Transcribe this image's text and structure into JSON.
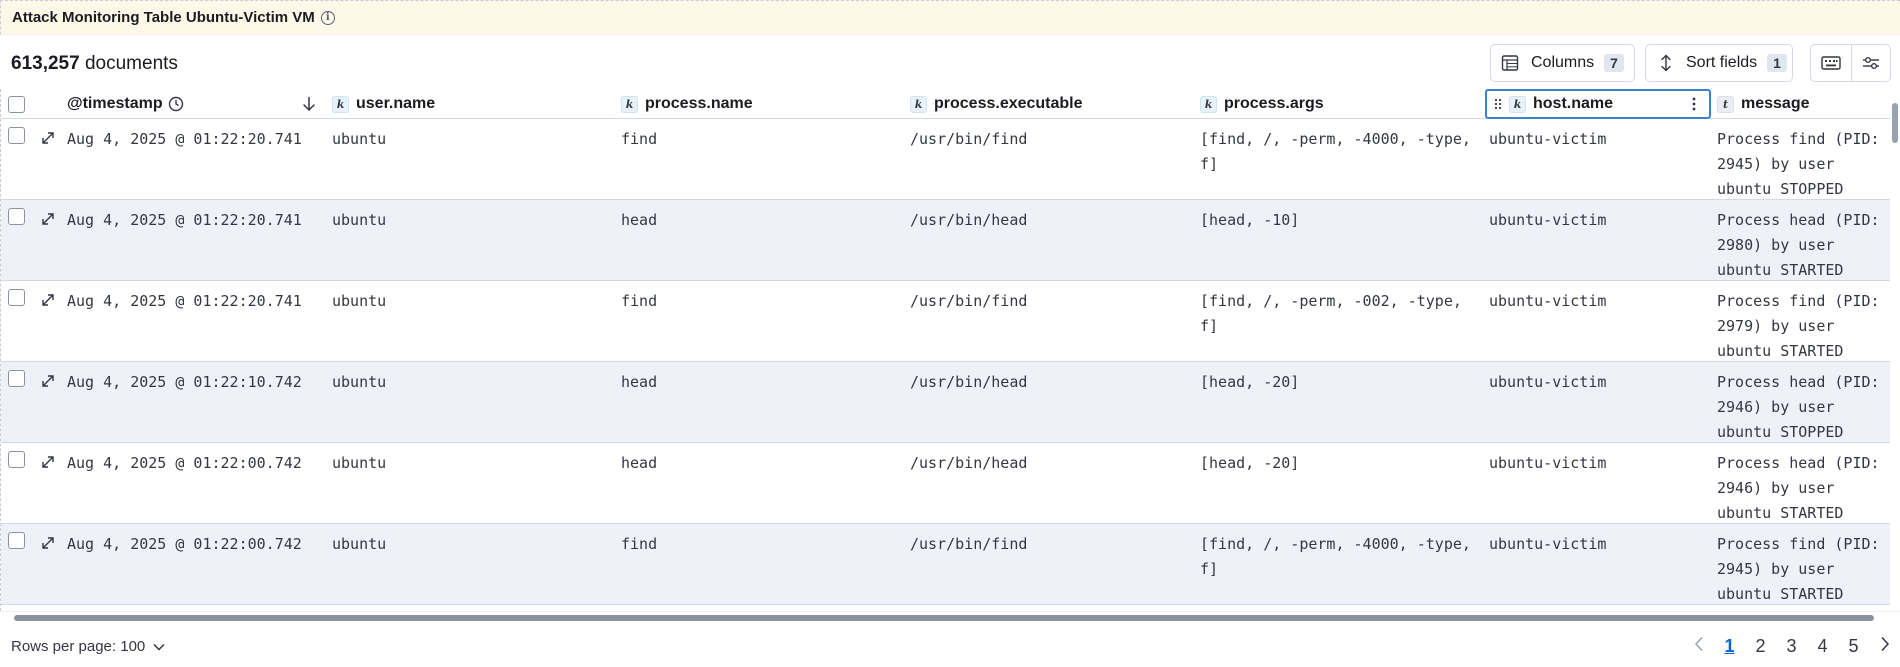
{
  "panel": {
    "title": "Attack Monitoring Table Ubuntu-Victim VM"
  },
  "toolbar": {
    "doc_count_number": "613,257",
    "doc_count_label": "documents",
    "columns_label": "Columns",
    "columns_count": "7",
    "sort_label": "Sort fields",
    "sort_count": "1"
  },
  "columns": [
    {
      "label": "@timestamp",
      "type": ""
    },
    {
      "label": "user.name",
      "type": "k"
    },
    {
      "label": "process.name",
      "type": "k"
    },
    {
      "label": "process.executable",
      "type": "k"
    },
    {
      "label": "process.args",
      "type": "k"
    },
    {
      "label": "host.name",
      "type": "k"
    },
    {
      "label": "message",
      "type": "t"
    }
  ],
  "rows": [
    {
      "timestamp": "Aug 4, 2025 @ 01:22:20.741",
      "user": "ubuntu",
      "process": "find",
      "executable": "/usr/bin/find",
      "args": "[find, /, -perm, -4000, -type, f]",
      "host": "ubuntu-victim",
      "message": "Process find (PID: 2945) by user ubuntu STOPPED"
    },
    {
      "timestamp": "Aug 4, 2025 @ 01:22:20.741",
      "user": "ubuntu",
      "process": "head",
      "executable": "/usr/bin/head",
      "args": "[head, -10]",
      "host": "ubuntu-victim",
      "message": "Process head (PID: 2980) by user ubuntu STARTED"
    },
    {
      "timestamp": "Aug 4, 2025 @ 01:22:20.741",
      "user": "ubuntu",
      "process": "find",
      "executable": "/usr/bin/find",
      "args": "[find, /, -perm, -002, -type, f]",
      "host": "ubuntu-victim",
      "message": "Process find (PID: 2979) by user ubuntu STARTED"
    },
    {
      "timestamp": "Aug 4, 2025 @ 01:22:10.742",
      "user": "ubuntu",
      "process": "head",
      "executable": "/usr/bin/head",
      "args": "[head, -20]",
      "host": "ubuntu-victim",
      "message": "Process head (PID: 2946) by user ubuntu STOPPED"
    },
    {
      "timestamp": "Aug 4, 2025 @ 01:22:00.742",
      "user": "ubuntu",
      "process": "head",
      "executable": "/usr/bin/head",
      "args": "[head, -20]",
      "host": "ubuntu-victim",
      "message": "Process head (PID: 2946) by user ubuntu STARTED"
    },
    {
      "timestamp": "Aug 4, 2025 @ 01:22:00.742",
      "user": "ubuntu",
      "process": "find",
      "executable": "/usr/bin/find",
      "args": "[find, /, -perm, -4000, -type, f]",
      "host": "ubuntu-victim",
      "message": "Process find (PID: 2945) by user ubuntu STARTED"
    }
  ],
  "footer": {
    "rows_per_page": "Rows per page: 100",
    "pages": [
      "1",
      "2",
      "3",
      "4",
      "5"
    ],
    "current_page": "1"
  }
}
